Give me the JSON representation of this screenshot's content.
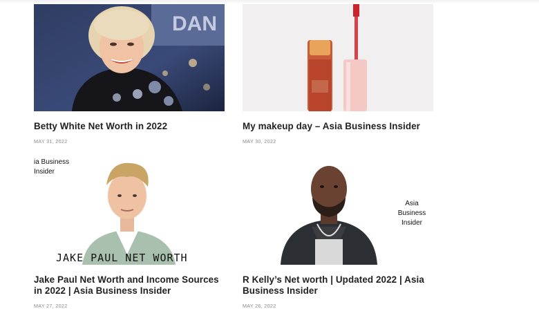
{
  "posts": [
    {
      "title": "Betty White Net Worth in 2022",
      "date": "MAY 31, 2022"
    },
    {
      "title": "My makeup day – Asia Business Insider",
      "date": "MAY 30, 2022"
    },
    {
      "title": "Jake Paul Net Worth and Income Sources in 2022 | Asia Business Insider",
      "date": "MAY 27, 2022",
      "watermark": "ia Business\nInsider",
      "overlay": "JAKE PAUL NET WORTH"
    },
    {
      "title": "R Kelly’s Net worth | Updated 2022 | Asia Business Insider",
      "date": "MAY 26, 2022",
      "watermark": "Asia Business\nInsider"
    }
  ]
}
